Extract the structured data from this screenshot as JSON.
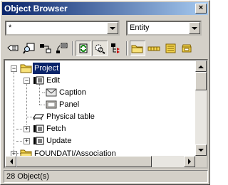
{
  "window": {
    "title": "Object Browser",
    "close_glyph": "×"
  },
  "filter": {
    "value": "*"
  },
  "type_combo": {
    "value": "Entity"
  },
  "toolbar": {
    "icons": [
      "catalog-icon",
      "find-icon",
      "links-icon",
      "hierarchy-icon",
      "refresh-icon",
      "filter-icon",
      "tree-expand-icon",
      "folder-view-icon",
      "field-view-icon",
      "table-view-icon",
      "key-view-icon"
    ]
  },
  "tree": {
    "items": [
      {
        "label": "Project",
        "selected": true,
        "icon": "folder-icon",
        "expander": "−"
      },
      {
        "label": "Edit",
        "icon": "edit-entity-icon",
        "expander": "−"
      },
      {
        "label": "Caption",
        "icon": "caption-icon"
      },
      {
        "label": "Panel",
        "icon": "panel-icon"
      },
      {
        "label": "Physical table",
        "icon": "physical-table-icon"
      },
      {
        "label": "Fetch",
        "icon": "fetch-entity-icon",
        "expander": "+"
      },
      {
        "label": "Update",
        "icon": "update-entity-icon",
        "expander": "+"
      },
      {
        "label": "FOUNDATI/Association",
        "icon": "folder-icon",
        "expander": "+"
      }
    ]
  },
  "status": {
    "text": "28 Object(s)"
  },
  "colors": {
    "title_start": "#0a246a",
    "title_end": "#a6caf0",
    "selection": "#0a246a",
    "face": "#d4d0c8",
    "folder": "#f5d64f"
  }
}
